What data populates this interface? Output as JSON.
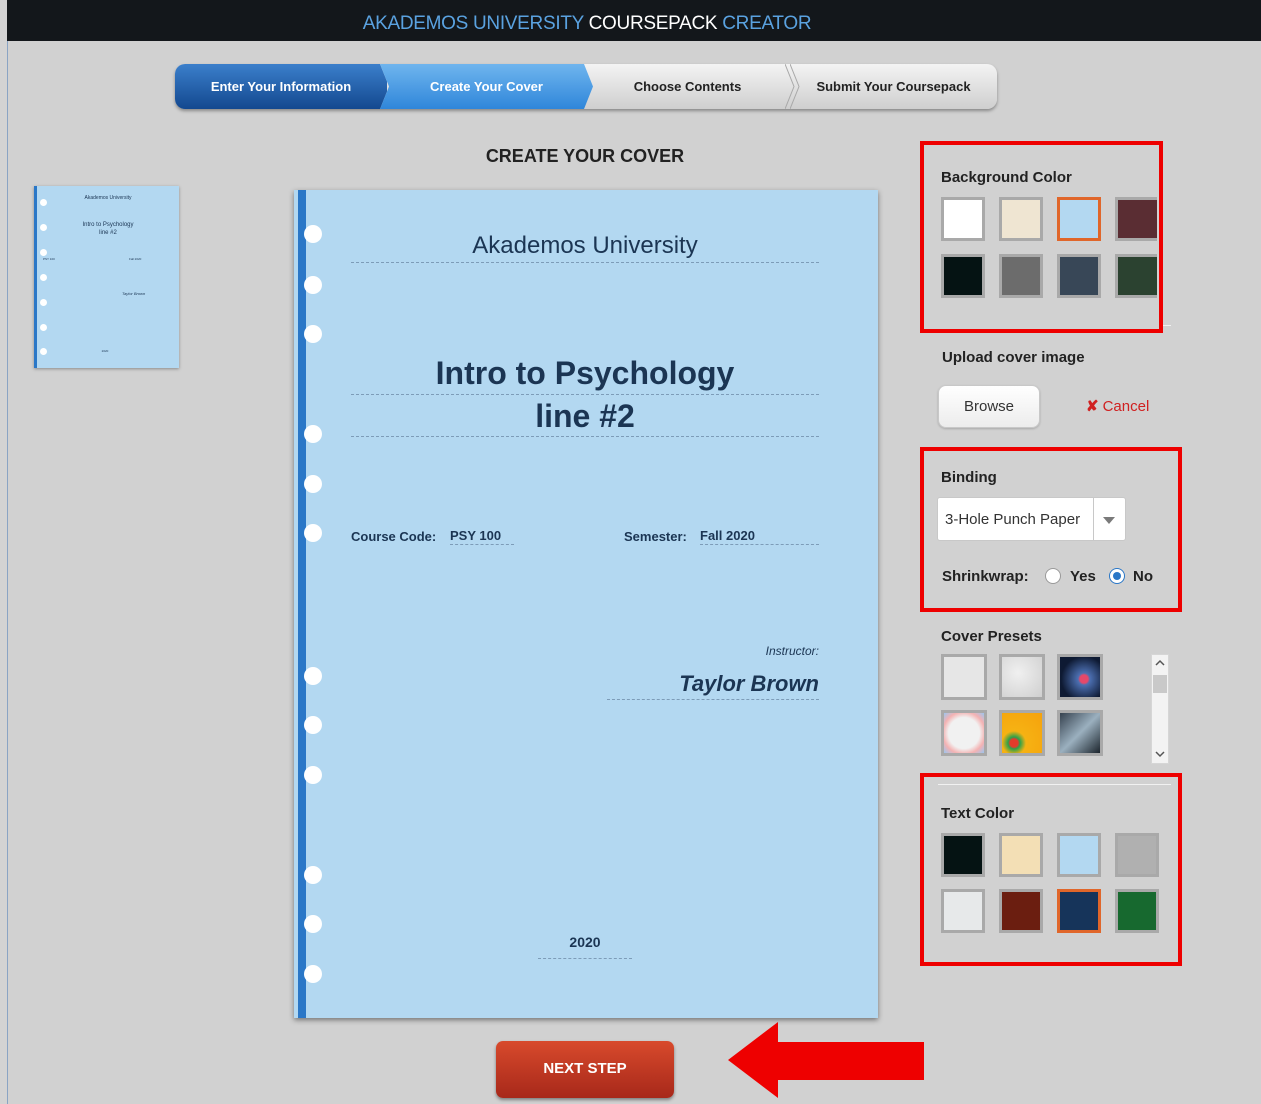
{
  "header": {
    "title_part1": "AKADEMOS UNIVERSITY",
    "title_part2": "COURSEPACK",
    "title_part3": "CREATOR"
  },
  "steps": [
    {
      "label": "Enter Your Information",
      "state": "completed"
    },
    {
      "label": "Create Your Cover",
      "state": "active"
    },
    {
      "label": "Choose Contents",
      "state": "pending"
    },
    {
      "label": "Submit Your Coursepack",
      "state": "pending"
    }
  ],
  "page_title": "CREATE YOUR COVER",
  "cover": {
    "university": "Akademos University",
    "title_line1": "Intro to Psychology",
    "title_line2": "line #2",
    "course_code_label": "Course Code:",
    "course_code": "PSY 100",
    "semester_label": "Semester:",
    "semester": "Fall 2020",
    "instructor_label": "Instructor:",
    "instructor": "Taylor Brown",
    "year": "2020",
    "background_color": "#b3d8f1",
    "text_color": "#1b3553"
  },
  "background_color": {
    "label": "Background Color",
    "swatches": [
      "#ffffff",
      "#efe5d2",
      "#b3d8f1",
      "#5a2d33",
      "#051313",
      "#6c6c6c",
      "#384757",
      "#2b4230"
    ],
    "selected_index": 2
  },
  "upload": {
    "label": "Upload cover image",
    "browse_label": "Browse",
    "cancel_label": "Cancel"
  },
  "binding": {
    "label": "Binding",
    "selected": "3-Hole Punch Paper",
    "shrinkwrap_label": "Shrinkwrap:",
    "shrinkwrap_yes": "Yes",
    "shrinkwrap_no": "No",
    "shrinkwrap_value": "No"
  },
  "cover_presets": {
    "label": "Cover Presets",
    "presets": [
      "light-gray",
      "marble-gray",
      "night-lights",
      "floral-white",
      "orange-flower",
      "city-street"
    ]
  },
  "text_color": {
    "label": "Text Color",
    "swatches": [
      "#051313",
      "#f3dfb5",
      "#b3d8f1",
      "#b0b0b0",
      "#e7e9ea",
      "#6b1e10",
      "#16345a",
      "#17692f"
    ],
    "selected_index": 6
  },
  "next_button": "NEXT STEP",
  "annotation_color": "#ee0000"
}
